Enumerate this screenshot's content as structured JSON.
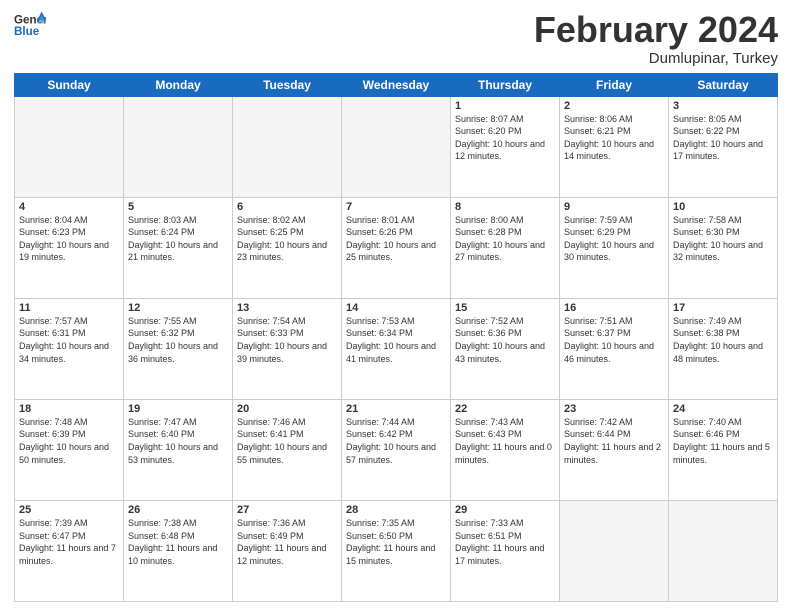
{
  "header": {
    "logo_general": "General",
    "logo_blue": "Blue",
    "title": "February 2024",
    "subtitle": "Dumlupinar, Turkey"
  },
  "weekdays": [
    "Sunday",
    "Monday",
    "Tuesday",
    "Wednesday",
    "Thursday",
    "Friday",
    "Saturday"
  ],
  "weeks": [
    [
      {
        "day": "",
        "empty": true
      },
      {
        "day": "",
        "empty": true
      },
      {
        "day": "",
        "empty": true
      },
      {
        "day": "",
        "empty": true
      },
      {
        "day": "1",
        "sunrise": "8:07 AM",
        "sunset": "6:20 PM",
        "daylight": "10 hours and 12 minutes."
      },
      {
        "day": "2",
        "sunrise": "8:06 AM",
        "sunset": "6:21 PM",
        "daylight": "10 hours and 14 minutes."
      },
      {
        "day": "3",
        "sunrise": "8:05 AM",
        "sunset": "6:22 PM",
        "daylight": "10 hours and 17 minutes."
      }
    ],
    [
      {
        "day": "4",
        "sunrise": "8:04 AM",
        "sunset": "6:23 PM",
        "daylight": "10 hours and 19 minutes."
      },
      {
        "day": "5",
        "sunrise": "8:03 AM",
        "sunset": "6:24 PM",
        "daylight": "10 hours and 21 minutes."
      },
      {
        "day": "6",
        "sunrise": "8:02 AM",
        "sunset": "6:25 PM",
        "daylight": "10 hours and 23 minutes."
      },
      {
        "day": "7",
        "sunrise": "8:01 AM",
        "sunset": "6:26 PM",
        "daylight": "10 hours and 25 minutes."
      },
      {
        "day": "8",
        "sunrise": "8:00 AM",
        "sunset": "6:28 PM",
        "daylight": "10 hours and 27 minutes."
      },
      {
        "day": "9",
        "sunrise": "7:59 AM",
        "sunset": "6:29 PM",
        "daylight": "10 hours and 30 minutes."
      },
      {
        "day": "10",
        "sunrise": "7:58 AM",
        "sunset": "6:30 PM",
        "daylight": "10 hours and 32 minutes."
      }
    ],
    [
      {
        "day": "11",
        "sunrise": "7:57 AM",
        "sunset": "6:31 PM",
        "daylight": "10 hours and 34 minutes."
      },
      {
        "day": "12",
        "sunrise": "7:55 AM",
        "sunset": "6:32 PM",
        "daylight": "10 hours and 36 minutes."
      },
      {
        "day": "13",
        "sunrise": "7:54 AM",
        "sunset": "6:33 PM",
        "daylight": "10 hours and 39 minutes."
      },
      {
        "day": "14",
        "sunrise": "7:53 AM",
        "sunset": "6:34 PM",
        "daylight": "10 hours and 41 minutes."
      },
      {
        "day": "15",
        "sunrise": "7:52 AM",
        "sunset": "6:36 PM",
        "daylight": "10 hours and 43 minutes."
      },
      {
        "day": "16",
        "sunrise": "7:51 AM",
        "sunset": "6:37 PM",
        "daylight": "10 hours and 46 minutes."
      },
      {
        "day": "17",
        "sunrise": "7:49 AM",
        "sunset": "6:38 PM",
        "daylight": "10 hours and 48 minutes."
      }
    ],
    [
      {
        "day": "18",
        "sunrise": "7:48 AM",
        "sunset": "6:39 PM",
        "daylight": "10 hours and 50 minutes."
      },
      {
        "day": "19",
        "sunrise": "7:47 AM",
        "sunset": "6:40 PM",
        "daylight": "10 hours and 53 minutes."
      },
      {
        "day": "20",
        "sunrise": "7:46 AM",
        "sunset": "6:41 PM",
        "daylight": "10 hours and 55 minutes."
      },
      {
        "day": "21",
        "sunrise": "7:44 AM",
        "sunset": "6:42 PM",
        "daylight": "10 hours and 57 minutes."
      },
      {
        "day": "22",
        "sunrise": "7:43 AM",
        "sunset": "6:43 PM",
        "daylight": "11 hours and 0 minutes."
      },
      {
        "day": "23",
        "sunrise": "7:42 AM",
        "sunset": "6:44 PM",
        "daylight": "11 hours and 2 minutes."
      },
      {
        "day": "24",
        "sunrise": "7:40 AM",
        "sunset": "6:46 PM",
        "daylight": "11 hours and 5 minutes."
      }
    ],
    [
      {
        "day": "25",
        "sunrise": "7:39 AM",
        "sunset": "6:47 PM",
        "daylight": "11 hours and 7 minutes."
      },
      {
        "day": "26",
        "sunrise": "7:38 AM",
        "sunset": "6:48 PM",
        "daylight": "11 hours and 10 minutes."
      },
      {
        "day": "27",
        "sunrise": "7:36 AM",
        "sunset": "6:49 PM",
        "daylight": "11 hours and 12 minutes."
      },
      {
        "day": "28",
        "sunrise": "7:35 AM",
        "sunset": "6:50 PM",
        "daylight": "11 hours and 15 minutes."
      },
      {
        "day": "29",
        "sunrise": "7:33 AM",
        "sunset": "6:51 PM",
        "daylight": "11 hours and 17 minutes."
      },
      {
        "day": "",
        "empty": true
      },
      {
        "day": "",
        "empty": true
      }
    ]
  ]
}
